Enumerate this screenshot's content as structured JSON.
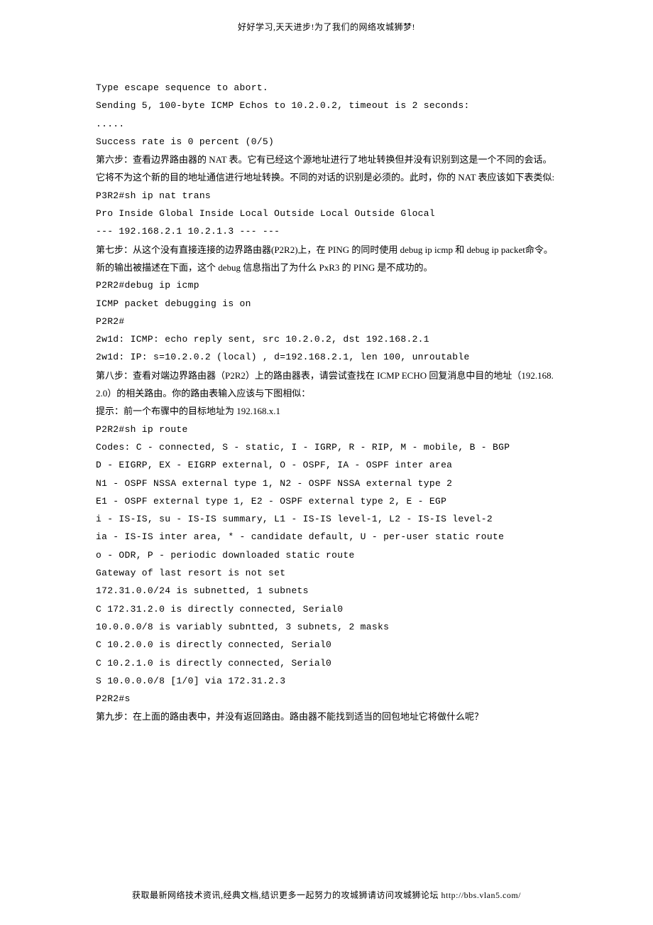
{
  "header": "好好学习,天天进步!为了我们的网络攻城狮梦!",
  "lines": [
    "Type escape sequence to abort.",
    "Sending 5, 100-byte ICMP Echos to 10.2.0.2, timeout is 2 seconds:",
    ".....",
    "Success rate is 0 percent (0/5)",
    "",
    "第六步：查看边界路由器的 NAT 表。它有已经这个源地址进行了地址转换但并没有识别到这是一个不同的会话。它将不为这个新的目的地址通信进行地址转换。不同的对话的识别是必须的。此时，你的 NAT 表应该如下表类似:",
    "P3R2#sh ip nat trans",
    "Pro Inside Global Inside Local Outside Local Outside Glocal",
    "--- 192.168.2.1 10.2.1.3 --- ---",
    "",
    "第七步：从这个没有直接连接的边界路由器(P2R2)上，在 PING 的同时使用 debug ip icmp 和 debug ip packet命令。新的输出被描述在下面，这个 debug 信息指出了为什么 PxR3 的 PING 是不成功的。",
    "P2R2#debug ip icmp",
    "ICMP packet debugging is on",
    "P2R2#",
    "2w1d: ICMP: echo reply sent, src 10.2.0.2, dst 192.168.2.1",
    "2w1d: IP: s=10.2.0.2 (local) , d=192.168.2.1, len 100, unroutable",
    "",
    "第八步：查看对端边界路由器（P2R2）上的路由器表，请尝试查找在 ICMP ECHO 回复消息中目的地址（192.168.2.0）的相关路由。你的路由表输入应该与下图相似：",
    "提示：前一个布骤中的目标地址为 192.168.x.1",
    "",
    "P2R2#sh ip route",
    "Codes: C - connected, S - static, I - IGRP, R - RIP, M - mobile, B - BGP",
    "D - EIGRP, EX - EIGRP external, O - OSPF, IA - OSPF inter area",
    "N1 - OSPF NSSA external type 1, N2 - OSPF NSSA external type 2",
    "E1 - OSPF external type 1, E2 - OSPF external type 2, E - EGP",
    "i - IS-IS, su - IS-IS summary, L1 - IS-IS level-1, L2 - IS-IS level-2",
    "ia - IS-IS inter area, * - candidate default, U - per-user static route",
    "o - ODR, P - periodic downloaded static route",
    "",
    "Gateway of last resort is not set",
    "",
    "172.31.0.0/24 is subnetted, 1 subnets",
    "C 172.31.2.0 is directly connected, Serial0",
    "10.0.0.0/8 is variably subntted, 3 subnets, 2 masks",
    "C 10.2.0.0 is directly connected, Serial0",
    "C 10.2.1.0 is directly connected, Serial0",
    "S 10.0.0.0/8 [1/0] via 172.31.2.3",
    "P2R2#s",
    "",
    "第九步：在上面的路由表中，并没有返回路由。路由器不能找到适当的回包地址它将做什么呢？"
  ],
  "footer": "获取最新网络技术资讯,经典文档,结识更多一起努力的攻城狮请访问攻城狮论坛 http://bbs.vlan5.com/"
}
